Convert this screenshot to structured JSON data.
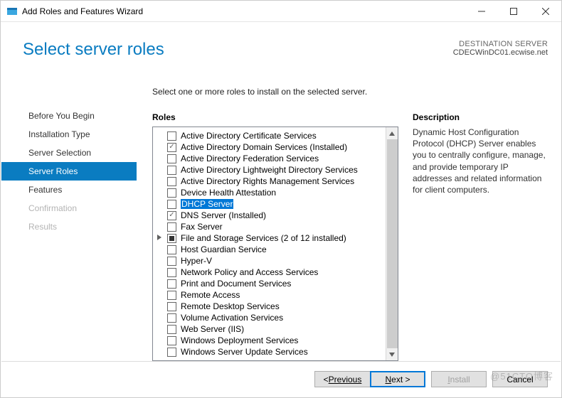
{
  "window": {
    "title": "Add Roles and Features Wizard"
  },
  "header": {
    "page_title": "Select server roles",
    "dest_label": "DESTINATION SERVER",
    "dest_name": "CDECWinDC01.ecwise.net"
  },
  "sidebar": {
    "items": [
      {
        "label": "Before You Begin",
        "active": false,
        "disabled": false
      },
      {
        "label": "Installation Type",
        "active": false,
        "disabled": false
      },
      {
        "label": "Server Selection",
        "active": false,
        "disabled": false
      },
      {
        "label": "Server Roles",
        "active": true,
        "disabled": false
      },
      {
        "label": "Features",
        "active": false,
        "disabled": false
      },
      {
        "label": "Confirmation",
        "active": false,
        "disabled": true
      },
      {
        "label": "Results",
        "active": false,
        "disabled": true
      }
    ]
  },
  "main": {
    "instruction": "Select one or more roles to install on the selected server.",
    "roles_header": "Roles",
    "roles": [
      {
        "label": "Active Directory Certificate Services",
        "state": "unchecked"
      },
      {
        "label": "Active Directory Domain Services (Installed)",
        "state": "checked"
      },
      {
        "label": "Active Directory Federation Services",
        "state": "unchecked"
      },
      {
        "label": "Active Directory Lightweight Directory Services",
        "state": "unchecked"
      },
      {
        "label": "Active Directory Rights Management Services",
        "state": "unchecked"
      },
      {
        "label": "Device Health Attestation",
        "state": "unchecked"
      },
      {
        "label": "DHCP Server",
        "state": "unchecked",
        "highlighted": true
      },
      {
        "label": "DNS Server (Installed)",
        "state": "checked"
      },
      {
        "label": "Fax Server",
        "state": "unchecked"
      },
      {
        "label": "File and Storage Services (2 of 12 installed)",
        "state": "indeterminate",
        "expandable": true
      },
      {
        "label": "Host Guardian Service",
        "state": "unchecked"
      },
      {
        "label": "Hyper-V",
        "state": "unchecked"
      },
      {
        "label": "Network Policy and Access Services",
        "state": "unchecked"
      },
      {
        "label": "Print and Document Services",
        "state": "unchecked"
      },
      {
        "label": "Remote Access",
        "state": "unchecked"
      },
      {
        "label": "Remote Desktop Services",
        "state": "unchecked"
      },
      {
        "label": "Volume Activation Services",
        "state": "unchecked"
      },
      {
        "label": "Web Server (IIS)",
        "state": "unchecked"
      },
      {
        "label": "Windows Deployment Services",
        "state": "unchecked"
      },
      {
        "label": "Windows Server Update Services",
        "state": "unchecked"
      }
    ],
    "description_header": "Description",
    "description_text": "Dynamic Host Configuration Protocol (DHCP) Server enables you to centrally configure, manage, and provide temporary IP addresses and related information for client computers."
  },
  "footer": {
    "previous": "Previous",
    "next": "Next >",
    "install": "Install",
    "cancel": "Cancel"
  },
  "watermark": "@51CTO博客"
}
